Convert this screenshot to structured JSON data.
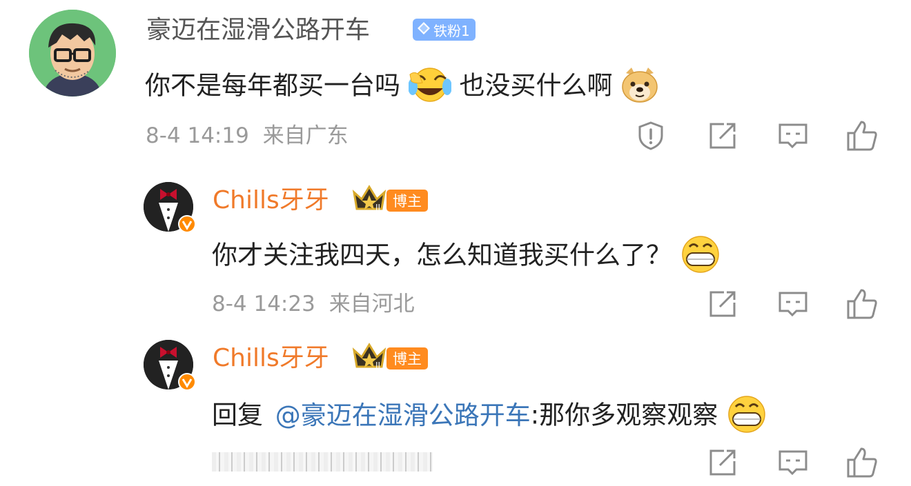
{
  "comment": {
    "username": "豪迈在湿滑公路开车",
    "fan_badge": "铁粉1",
    "text_part1": "你不是每年都买一台吗",
    "text_part2": "也没买什么啊",
    "timestamp": "8-4 14:19",
    "location": "来自广东",
    "colors": {
      "username": "#555555",
      "fan_badge": "#7fb2ff"
    }
  },
  "replies": [
    {
      "username": "Chills牙牙",
      "host_badge": "博主",
      "text": "你才关注我四天，怎么知道我买什么了？",
      "timestamp": "8-4 14:23",
      "location": "来自河北"
    },
    {
      "username": "Chills牙牙",
      "host_badge": "博主",
      "reply_prefix": "回复",
      "mention": "@豪迈在湿滑公路开车",
      "text": ":那你多观察观察"
    }
  ],
  "icons": {
    "report": "shield-exclamation-icon",
    "share": "share-edit-icon",
    "comment": "comment-icon",
    "like": "thumbs-up-icon",
    "verified": "verified-v-icon",
    "crown": "crown-icon",
    "diamond": "diamond-icon"
  },
  "colors": {
    "host_name": "#f07a2a",
    "host_badge": "#ff8b1f",
    "mention": "#3b76b8",
    "meta": "#9a9a9a",
    "icon_stroke": "#8c8c8c"
  }
}
